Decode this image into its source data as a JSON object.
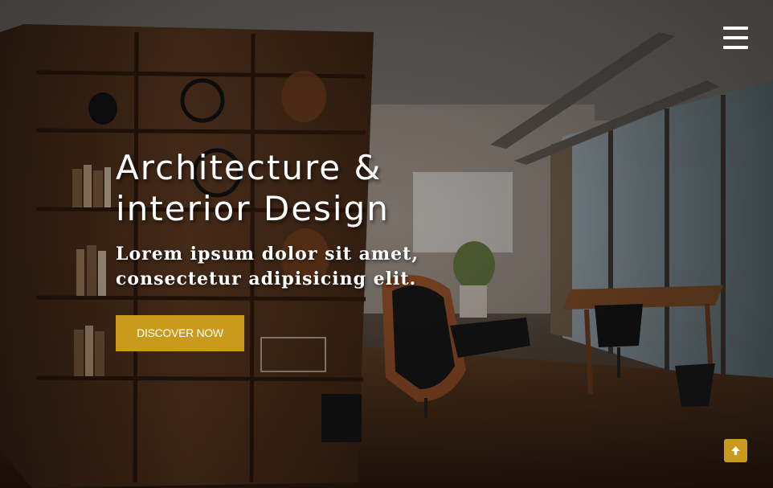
{
  "hero": {
    "title_line1": "Architecture &",
    "title_line2": "interior Design",
    "subtitle": "Lorem ipsum dolor sit amet, consectetur adipisicing elit.",
    "cta_label": "DISCOVER NOW"
  },
  "icons": {
    "menu": "hamburger-menu-icon",
    "scroll_top": "arrow-up-icon",
    "background": "office-interior-photo"
  },
  "colors": {
    "accent": "#c99a1c",
    "text": "#ffffff"
  }
}
